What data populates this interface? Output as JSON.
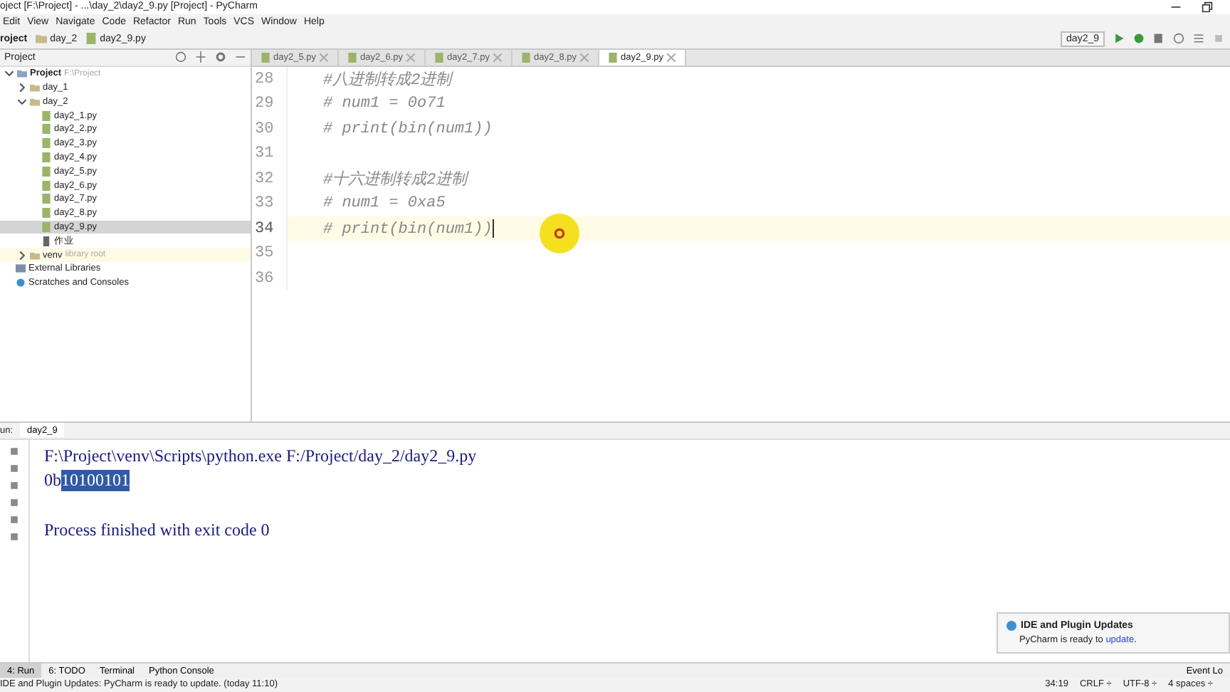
{
  "window": {
    "title": "oject [F:\\Project] - ...\\day_2\\day2_9.py [Project] - PyCharm"
  },
  "menu": [
    "Edit",
    "View",
    "Navigate",
    "Code",
    "Refactor",
    "Run",
    "Tools",
    "VCS",
    "Window",
    "Help"
  ],
  "breadcrumbs": [
    "roject",
    "day_2",
    "day2_9.py"
  ],
  "run_config": {
    "label": "day2_9"
  },
  "project_panel": {
    "title": "Project",
    "tree": [
      {
        "label": "Project",
        "hint": "F:\\Project",
        "kind": "root",
        "expanded": true,
        "selected": false,
        "children": [
          {
            "label": "day_1",
            "kind": "folder",
            "expanded": false,
            "selected": false
          },
          {
            "label": "day_2",
            "kind": "folder",
            "expanded": true,
            "selected": false,
            "children": [
              {
                "label": "day2_1.py",
                "kind": "py",
                "selected": false
              },
              {
                "label": "day2_2.py",
                "kind": "py",
                "selected": false
              },
              {
                "label": "day2_3.py",
                "kind": "py",
                "selected": false
              },
              {
                "label": "day2_4.py",
                "kind": "py",
                "selected": false
              },
              {
                "label": "day2_5.py",
                "kind": "py",
                "selected": false
              },
              {
                "label": "day2_6.py",
                "kind": "py",
                "selected": false
              },
              {
                "label": "day2_7.py",
                "kind": "py",
                "selected": false
              },
              {
                "label": "day2_8.py",
                "kind": "py",
                "selected": false
              },
              {
                "label": "day2_9.py",
                "kind": "py",
                "selected": true
              },
              {
                "label": "作业",
                "kind": "text",
                "selected": false
              }
            ]
          },
          {
            "label": "venv",
            "hint": "library root",
            "kind": "folder",
            "expanded": false,
            "selected": false
          }
        ]
      },
      {
        "label": "External Libraries",
        "kind": "lib",
        "selected": false
      },
      {
        "label": "Scratches and Consoles",
        "kind": "scratch",
        "selected": false
      }
    ]
  },
  "editor": {
    "tabs": [
      {
        "label": "day2_5.py",
        "selected": false
      },
      {
        "label": "day2_6.py",
        "selected": false
      },
      {
        "label": "day2_7.py",
        "selected": false
      },
      {
        "label": "day2_8.py",
        "selected": false
      },
      {
        "label": "day2_9.py",
        "selected": true
      }
    ],
    "lines": [
      {
        "number": "28",
        "text": "#八进制转成2进制",
        "current": false
      },
      {
        "number": "29",
        "text": "# num1 = 0o71",
        "current": false
      },
      {
        "number": "30",
        "text": "# print(bin(num1))",
        "current": false
      },
      {
        "number": "31",
        "current": false
      },
      {
        "number": "32",
        "text": "#十六进制转成2进制",
        "current": false
      },
      {
        "number": "33",
        "text": "# num1 = 0xa5",
        "current": false
      },
      {
        "number": "34",
        "text": "# print(bin(num1))",
        "current": true
      },
      {
        "number": "35",
        "current": false
      },
      {
        "number": "36",
        "current": false
      }
    ]
  },
  "run_panel": {
    "label": "un:",
    "tab": "day2_9",
    "output": [
      {
        "spaced": false,
        "segments": [
          {
            "text": "F:\\Project\\venv\\Scripts\\python.exe F:/Project/day_2/day2_9.py",
            "selected": false
          }
        ]
      },
      {
        "spaced": false,
        "segments": [
          {
            "text": "0b",
            "selected": false
          },
          {
            "text": "10100101",
            "selected": true
          }
        ]
      },
      {
        "spaced": true,
        "segments": [
          {
            "text": "Process finished with exit code 0",
            "selected": false
          }
        ]
      }
    ]
  },
  "notification": {
    "title": "IDE and Plugin Updates",
    "text_before": "PyCharm is ready to ",
    "link": "update",
    "text_after": "."
  },
  "tool_tabs": [
    {
      "label": "4: Run",
      "selected": true
    },
    {
      "label": "6: TODO",
      "selected": false
    },
    {
      "label": "Terminal",
      "selected": false
    },
    {
      "label": "Python Console",
      "selected": false
    }
  ],
  "event_log": "Event Lo",
  "status_bar": {
    "message": "IDE and Plugin Updates: PyCharm is ready to update. (today 11:10)",
    "position": "34:19",
    "line_sep": "CRLF ÷",
    "encoding": "UTF-8 ÷",
    "indent": "4 spaces ÷"
  }
}
